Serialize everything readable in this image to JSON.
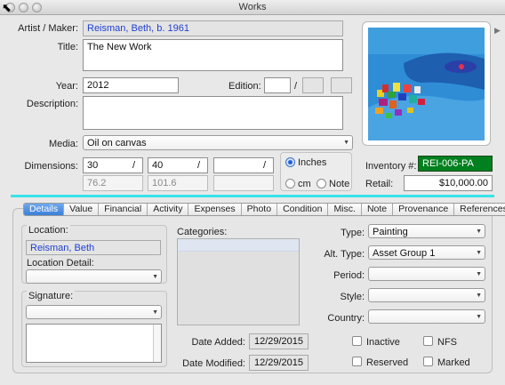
{
  "window": {
    "title": "Works"
  },
  "colors": {
    "accent": "#37e3e8",
    "inventory_bg": "#00801e",
    "link_blue": "#1e3fd0",
    "tab_active": "#3b7fd8"
  },
  "top": {
    "artist_label": "Artist / Maker:",
    "artist_value": "Reisman, Beth, b. 1961",
    "title_label": "Title:",
    "title_value": "The New Work",
    "year_label": "Year:",
    "year_value": "2012",
    "edition_label": "Edition:",
    "edition_value": "",
    "edition_sep": "/",
    "description_label": "Description:",
    "description_value": "",
    "media_label": "Media:",
    "media_value": "Oil on canvas",
    "dimensions_label": "Dimensions:",
    "dim1": "30",
    "dim2": "40",
    "dim3": "",
    "dim_sep": "/",
    "dim1_cm": "76.2",
    "dim2_cm": "101.6",
    "dim3_cm": "",
    "units": {
      "inches": "Inches",
      "cm": "cm",
      "note": "Note",
      "selected": "Inches"
    },
    "inventory_label": "Inventory #:",
    "inventory_value": "REI-006-PA",
    "retail_label": "Retail:",
    "retail_value": "$10,000.00"
  },
  "tabs": [
    "Details",
    "Value",
    "Financial",
    "Activity",
    "Expenses",
    "Photo",
    "Condition",
    "Misc.",
    "Note",
    "Provenance",
    "References"
  ],
  "details": {
    "location_label": "Location:",
    "location_value": "Reisman, Beth",
    "location_detail_label": "Location Detail:",
    "location_detail_value": "",
    "signature_label": "Signature:",
    "signature_value": "",
    "categories_label": "Categories:",
    "date_added_label": "Date Added:",
    "date_added_value": "12/29/2015",
    "date_modified_label": "Date Modified:",
    "date_modified_value": "12/29/2015",
    "type_label": "Type:",
    "type_value": "Painting",
    "alt_type_label": "Alt. Type:",
    "alt_type_value": "Asset Group 1",
    "period_label": "Period:",
    "period_value": "",
    "style_label": "Style:",
    "style_value": "",
    "country_label": "Country:",
    "country_value": "",
    "checkboxes": {
      "inactive": "Inactive",
      "nfs": "NFS",
      "reserved": "Reserved",
      "marked": "Marked"
    }
  }
}
